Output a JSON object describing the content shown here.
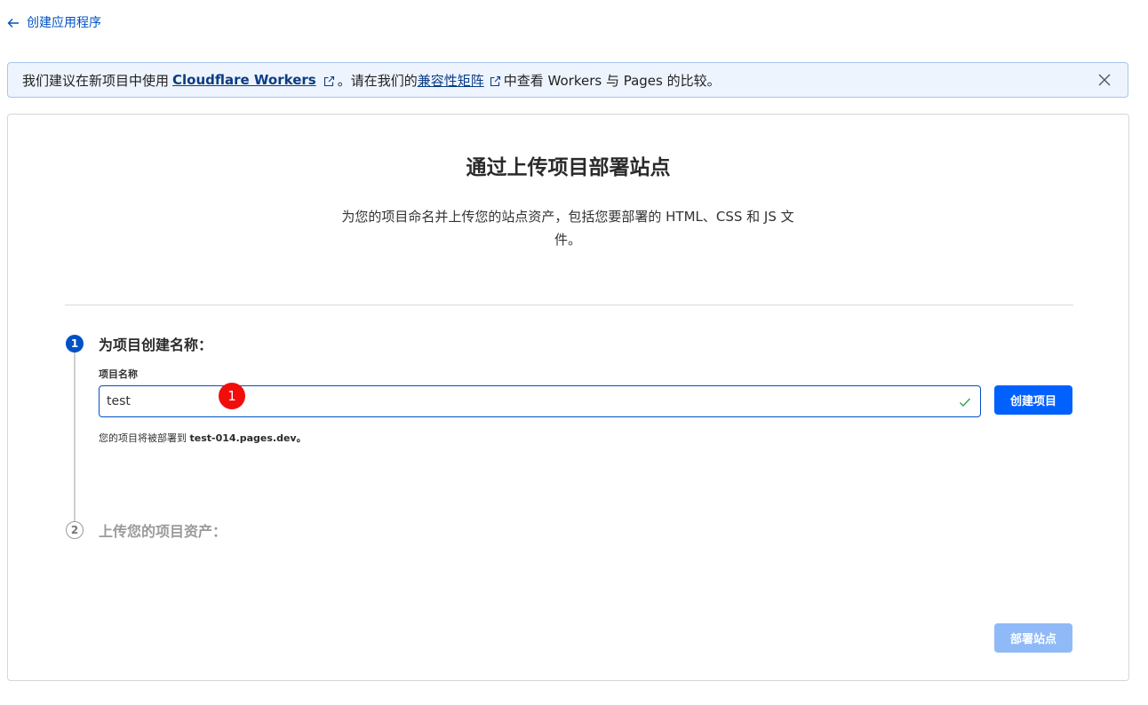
{
  "nav": {
    "back_label": "创建应用程序"
  },
  "banner": {
    "text_1": "我们建议在新项目中使用",
    "link_workers": "Cloudflare Workers",
    "text_2": "。请在我们的",
    "link_matrix": "兼容性矩阵",
    "text_3": "中查看 Workers 与 Pages 的比较。"
  },
  "card": {
    "title": "通过上传项目部署站点",
    "subtitle": "为您的项目命名并上传您的站点资产，包括您要部署的 HTML、CSS 和 JS 文件。"
  },
  "step1": {
    "number": "1",
    "title": "为项目创建名称：",
    "field_label": "项目名称",
    "input_value": "test",
    "create_button": "创建项目",
    "helper_prefix": "您的项目将被部署到",
    "helper_domain": "test-014.pages.dev。"
  },
  "step2": {
    "number": "2",
    "title": "上传您的项目资产："
  },
  "marker": {
    "label": "1"
  },
  "deploy_button": "部署站点",
  "colors": {
    "accent": "#0051c3",
    "button_primary": "#0061ff",
    "button_disabled": "#8fbaf7",
    "success": "#2ea44f",
    "marker": "#f20d0d"
  },
  "icons": {
    "back": "arrow-left-icon",
    "external": "external-link-icon",
    "close": "close-icon",
    "valid": "checkmark-icon"
  }
}
